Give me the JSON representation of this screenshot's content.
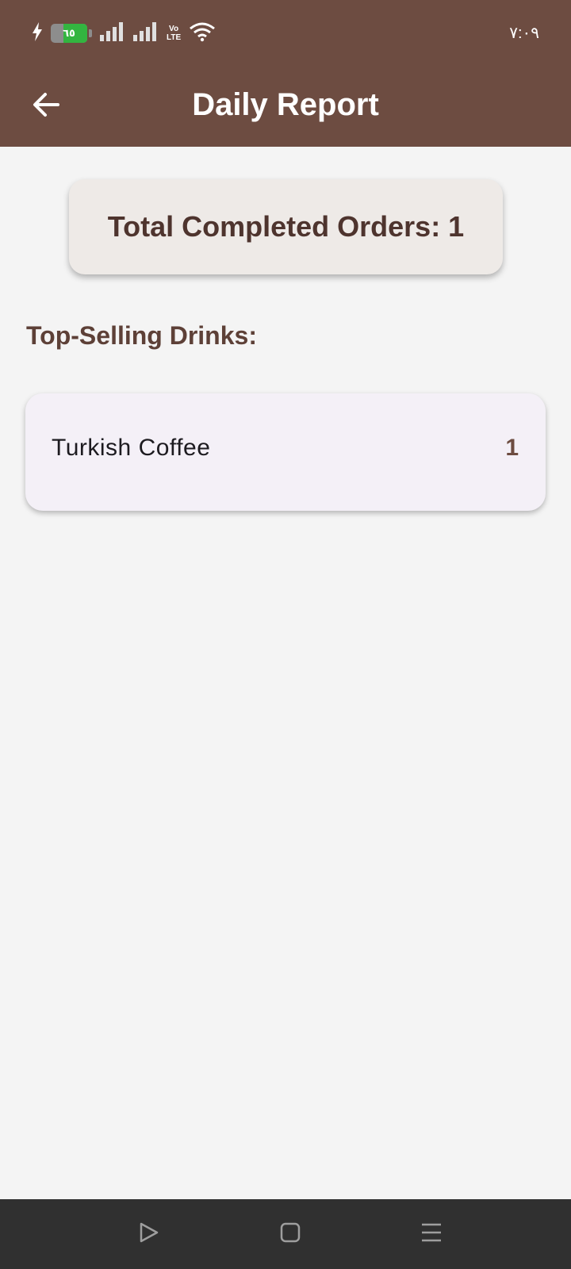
{
  "status_bar": {
    "battery_level": "٦٥",
    "battery_fraction": 0.65,
    "network_label_top": "Vo",
    "network_label_bottom": "LTE",
    "time": "٧:٠٩"
  },
  "app_bar": {
    "title": "Daily Report",
    "back_icon": "arrow-left-icon"
  },
  "summary": {
    "text": "Total Completed Orders: 1"
  },
  "section": {
    "title": "Top-Selling Drinks:"
  },
  "drinks": [
    {
      "name": "Turkish Coffee",
      "count": "1"
    }
  ],
  "nav_bar": {
    "icons": [
      "back-triangle-icon",
      "home-square-icon",
      "recents-menu-icon"
    ]
  },
  "colors": {
    "primary": "#6d4c41",
    "background": "#f4f4f4",
    "summary_card": "#eeeae7",
    "drink_card": "#f4f0f7",
    "text_dark": "#4e342e",
    "nav_bar": "#303030"
  }
}
